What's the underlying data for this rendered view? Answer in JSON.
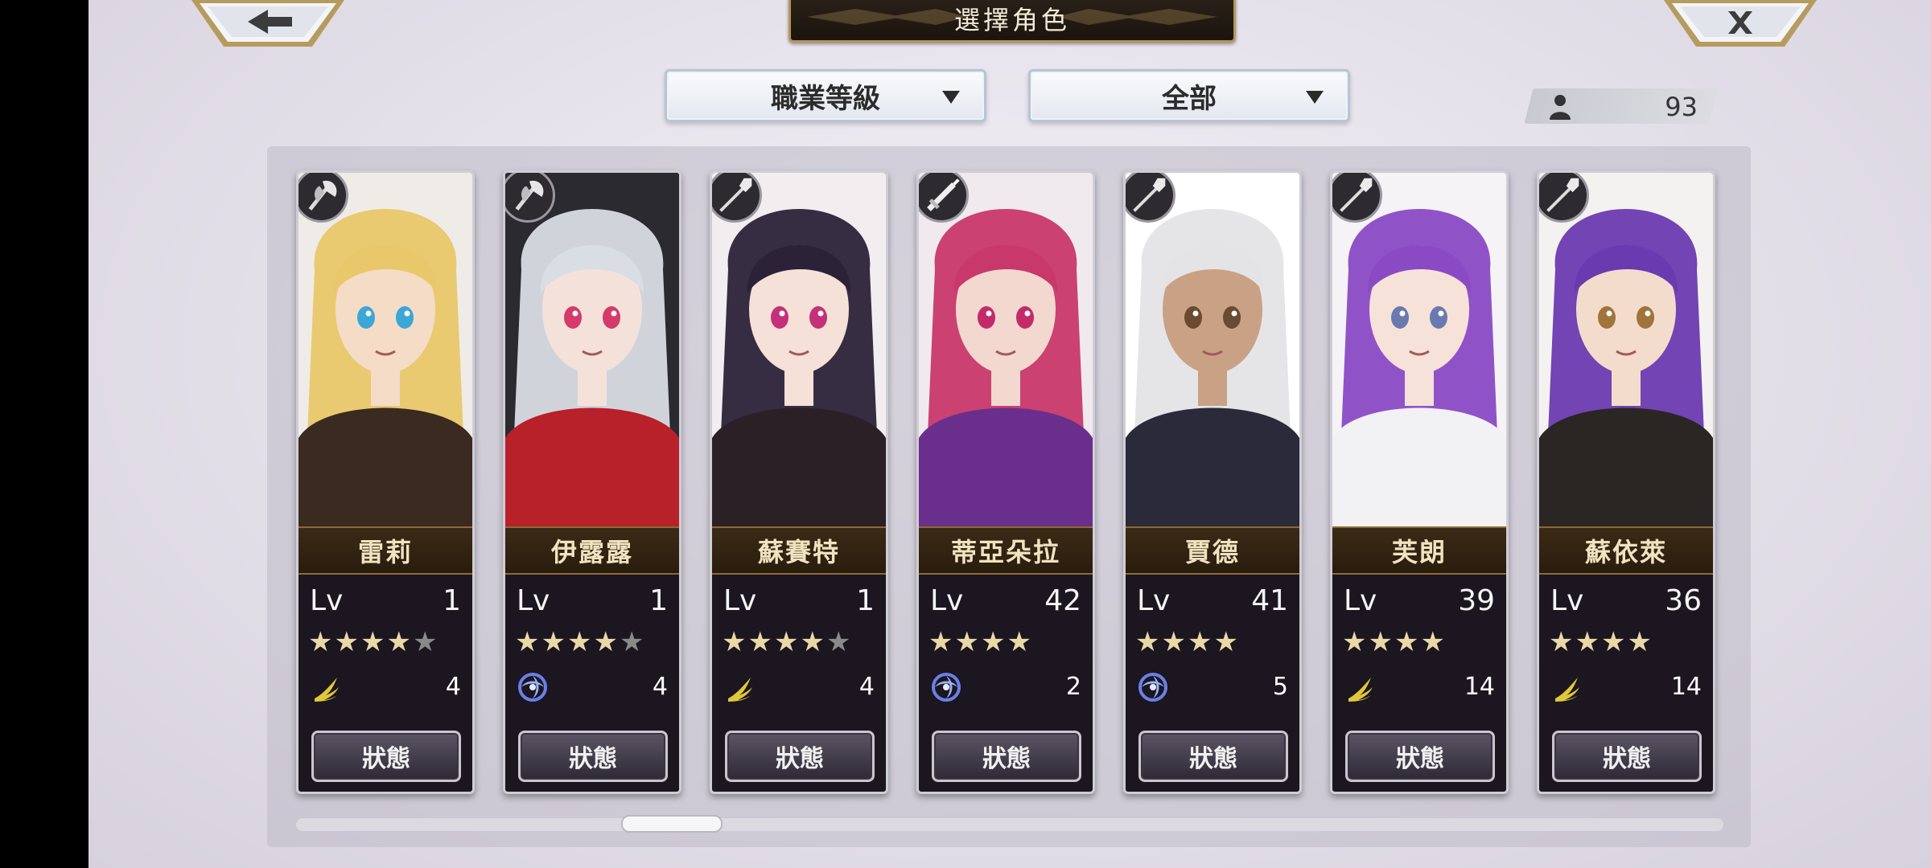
{
  "header": {
    "title": "選擇角色",
    "back_icon": "arrow-left-icon",
    "close_icon": "close-icon"
  },
  "filters": {
    "sort_label": "職業等級",
    "filter_label": "全部"
  },
  "roster": {
    "count": "93",
    "icon": "person-icon"
  },
  "colors": {
    "gold_accent": "#b59558",
    "star_on": "#e8d9a6",
    "star_off": "#8a8a8a"
  },
  "characters": [
    {
      "name": "雷莉",
      "lv_label": "Lv",
      "level": "1",
      "stars": 4,
      "max_stars": 5,
      "element": "wind",
      "count": "4",
      "status_label": "狀態",
      "weapon": "axe-icon",
      "palette": {
        "hair": "#e8c86a",
        "skin": "#f5dcc6",
        "outfit": "#3a2a20",
        "eye": "#3aa7d8",
        "bg": "#efece8"
      }
    },
    {
      "name": "伊露露",
      "lv_label": "Lv",
      "level": "1",
      "stars": 4,
      "max_stars": 5,
      "element": "water",
      "count": "4",
      "status_label": "狀態",
      "weapon": "axe-icon",
      "palette": {
        "hair": "#d9dde4",
        "skin": "#f4e2da",
        "outfit": "#b8212a",
        "eye": "#d43a6a",
        "bg": "#2a2a30"
      }
    },
    {
      "name": "蘇賽特",
      "lv_label": "Lv",
      "level": "1",
      "stars": 4,
      "max_stars": 5,
      "element": "wind",
      "count": "4",
      "status_label": "狀態",
      "weapon": "spear-icon",
      "palette": {
        "hair": "#2c2238",
        "skin": "#f6e1d8",
        "outfit": "#2a2026",
        "eye": "#c4307a",
        "bg": "#f2eef0"
      }
    },
    {
      "name": "蒂亞朵拉",
      "lv_label": "Lv",
      "level": "42",
      "stars": 4,
      "max_stars": 4,
      "element": "water",
      "count": "2",
      "status_label": "狀態",
      "weapon": "sword-icon",
      "palette": {
        "hair": "#c8386a",
        "skin": "#f3d8cf",
        "outfit": "#6a2f8c",
        "eye": "#c42a6a",
        "bg": "#f0eaee"
      }
    },
    {
      "name": "賈德",
      "lv_label": "Lv",
      "level": "41",
      "stars": 4,
      "max_stars": 4,
      "element": "water",
      "count": "5",
      "status_label": "狀態",
      "weapon": "spear-icon",
      "palette": {
        "hair": "#e4e4e6",
        "skin": "#c9a286",
        "outfit": "#2a2a3a",
        "eye": "#6a4a30",
        "bg": "#ffffff"
      }
    },
    {
      "name": "芙朗",
      "lv_label": "Lv",
      "level": "39",
      "stars": 4,
      "max_stars": 4,
      "element": "wind",
      "count": "14",
      "status_label": "狀態",
      "weapon": "spear-icon",
      "palette": {
        "hair": "#8a4ac4",
        "skin": "#f6e2d8",
        "outfit": "#f2f2f4",
        "eye": "#6a7ab0",
        "bg": "#f5f3f6"
      }
    },
    {
      "name": "蘇依萊",
      "lv_label": "Lv",
      "level": "36",
      "stars": 4,
      "max_stars": 4,
      "element": "wind",
      "count": "14",
      "status_label": "狀態",
      "weapon": "spear-icon",
      "palette": {
        "hair": "#6a3ab0",
        "skin": "#f3dccb",
        "outfit": "#2a2624",
        "eye": "#a0743a",
        "bg": "#f4f2f0"
      }
    }
  ]
}
